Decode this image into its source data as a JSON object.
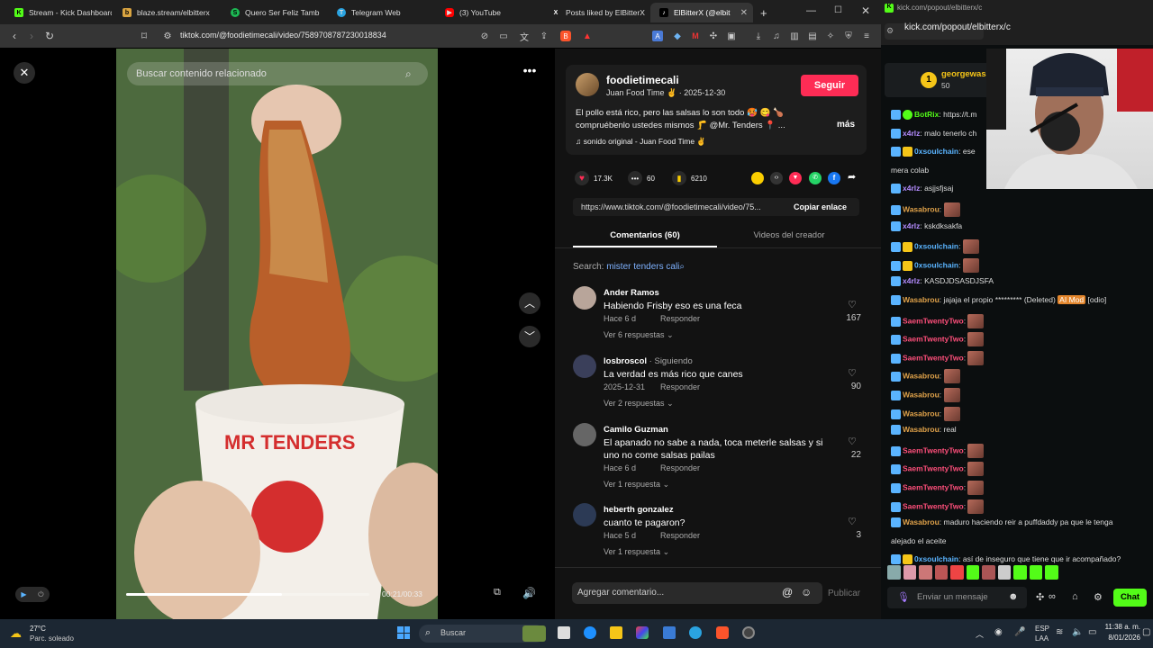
{
  "browser": {
    "tabs": [
      {
        "label": "Stream - Kick Dashboard",
        "color": "#53fc18",
        "glyph": "K"
      },
      {
        "label": "blaze.stream/elbitterx",
        "color": "#d9a441",
        "glyph": "b"
      },
      {
        "label": "Quero Ser Feliz Tamb",
        "color": "#1db954",
        "glyph": "S"
      },
      {
        "label": "Telegram Web",
        "color": "#2aa3e0",
        "glyph": "T"
      },
      {
        "label": "(3) YouTube",
        "color": "#ff0000",
        "glyph": "▶"
      },
      {
        "label": "Posts liked by ElBitterX",
        "color": "#ffffff",
        "glyph": "X"
      },
      {
        "label": "ElBitterX (@elbit",
        "color": "#ffffff",
        "glyph": "♪"
      }
    ],
    "url": "tiktok.com/@foodietimecali/video/7589708787230018834",
    "popout_url": "kick.com/popout/elbitterx/c",
    "popout_url2": "kick.com/popout/elbitterx/c"
  },
  "video": {
    "search_placeholder": "Buscar contenido relacionado",
    "time": "00:21/00:33",
    "progress": 0.64
  },
  "post": {
    "username": "foodietimecali",
    "subtitle": "Juan Food Time ✌️",
    "date": "2025-12-30",
    "follow_label": "Seguir",
    "caption": "El pollo está rico, pero las salsas lo son todo 🥵 😋 🍗 compruébenlo ustedes mismos 🦵 @Mr. Tenders 📍 ...",
    "more_label": "más",
    "sound": "sonido original - Juan Food Time ✌️",
    "likes": "17.3K",
    "comments_count": "60",
    "saves": "6210",
    "link": "https://www.tiktok.com/@foodietimecali/video/75...",
    "copy_label": "Copiar enlace",
    "tab_comments": "Comentarios (60)",
    "tab_creator": "Videos del creador",
    "search_label": "Search:",
    "search_term": "mister tenders cali",
    "comments": [
      {
        "author": "Ander Ramos",
        "text": "Habiendo Frisby eso es una feca",
        "meta": "Hace 6 d",
        "reply": "Responder",
        "likes": "167",
        "replies": "Ver 6 respuestas"
      },
      {
        "author": "losbroscol",
        "tag": " · Siguiendo",
        "text": "La verdad es más rico que canes",
        "meta": "2025-12-31",
        "reply": "Responder",
        "likes": "90",
        "replies": "Ver 2 respuestas"
      },
      {
        "author": "Camilo Guzman",
        "text": "El apanado no sabe a nada, toca meterle salsas y si uno no come salsas pailas",
        "meta": "Hace 6 d",
        "reply": "Responder",
        "likes": "22",
        "replies": "Ver 1 respuesta"
      },
      {
        "author": "heberth gonzalez",
        "text": "cuanto te pagaron?",
        "meta": "Hace 5 d",
        "reply": "Responder",
        "likes": "3",
        "replies": "Ver 1 respuesta"
      }
    ],
    "add_comment_placeholder": "Agregar comentario...",
    "publish_label": "Publicar"
  },
  "chat": {
    "gifter": "georgewas",
    "gift_count": "50",
    "messages": [
      {
        "user": "BotRix",
        "color": "#53fc18",
        "text": "https://t.m"
      },
      {
        "user": "x4rlz",
        "color": "#b48cff",
        "text": "malo tenerlo ch"
      },
      {
        "user": "0xsoulchain",
        "color": "#5ab4ff",
        "text": "ese"
      },
      {
        "user": "",
        "color": "#ffffff",
        "text": "mera colab"
      },
      {
        "user": "x4rlz",
        "color": "#b48cff",
        "text": "asjjsfjsaj"
      },
      {
        "user": "Wasabrou",
        "color": "#e0a24a",
        "text": ""
      },
      {
        "user": "x4rlz",
        "color": "#b48cff",
        "text": "kskdksakfa"
      },
      {
        "user": "0xsoulchain",
        "color": "#5ab4ff",
        "text": ""
      },
      {
        "user": "0xsoulchain",
        "color": "#5ab4ff",
        "text": ""
      },
      {
        "user": "x4rlz",
        "color": "#b48cff",
        "text": "KASDJDSASDJSFA"
      },
      {
        "user": "Wasabrou",
        "color": "#e0a24a",
        "text": "jajaja el propio ********* (Deleted)"
      },
      {
        "user": "SaemTwentyTwo",
        "color": "#ff4f7b",
        "text": ""
      },
      {
        "user": "SaemTwentyTwo",
        "color": "#ff4f7b",
        "text": ""
      },
      {
        "user": "SaemTwentyTwo",
        "color": "#ff4f7b",
        "text": ""
      },
      {
        "user": "Wasabrou",
        "color": "#e0a24a",
        "text": ""
      },
      {
        "user": "Wasabrou",
        "color": "#e0a24a",
        "text": ""
      },
      {
        "user": "Wasabrou",
        "color": "#e0a24a",
        "text": ""
      },
      {
        "user": "Wasabrou",
        "color": "#e0a24a",
        "text": "real"
      },
      {
        "user": "SaemTwentyTwo",
        "color": "#ff4f7b",
        "text": ""
      },
      {
        "user": "SaemTwentyTwo",
        "color": "#ff4f7b",
        "text": ""
      },
      {
        "user": "SaemTwentyTwo",
        "color": "#ff4f7b",
        "text": ""
      },
      {
        "user": "SaemTwentyTwo",
        "color": "#ff4f7b",
        "text": ""
      },
      {
        "user": "Wasabrou",
        "color": "#e0a24a",
        "text": "maduro haciendo reir a puffdaddy pa que le tenga"
      },
      {
        "user": "",
        "color": "#ffffff",
        "text": "alejado el aceite"
      },
      {
        "user": "0xsoulchain",
        "color": "#5ab4ff",
        "text": "así de inseguro que tiene que ir acompañado?"
      }
    ],
    "mod_tag": "AI Mod",
    "odio_tag": "[odio]",
    "input_placeholder": "Enviar un mensaje",
    "chat_button": "Chat"
  },
  "taskbar": {
    "weather_temp": "27°C",
    "weather_desc": "Parc. soleado",
    "search_placeholder": "Buscar",
    "lang": "ESP",
    "lang2": "LAA",
    "time": "11:38 a. m.",
    "date": "8/01/2026"
  }
}
